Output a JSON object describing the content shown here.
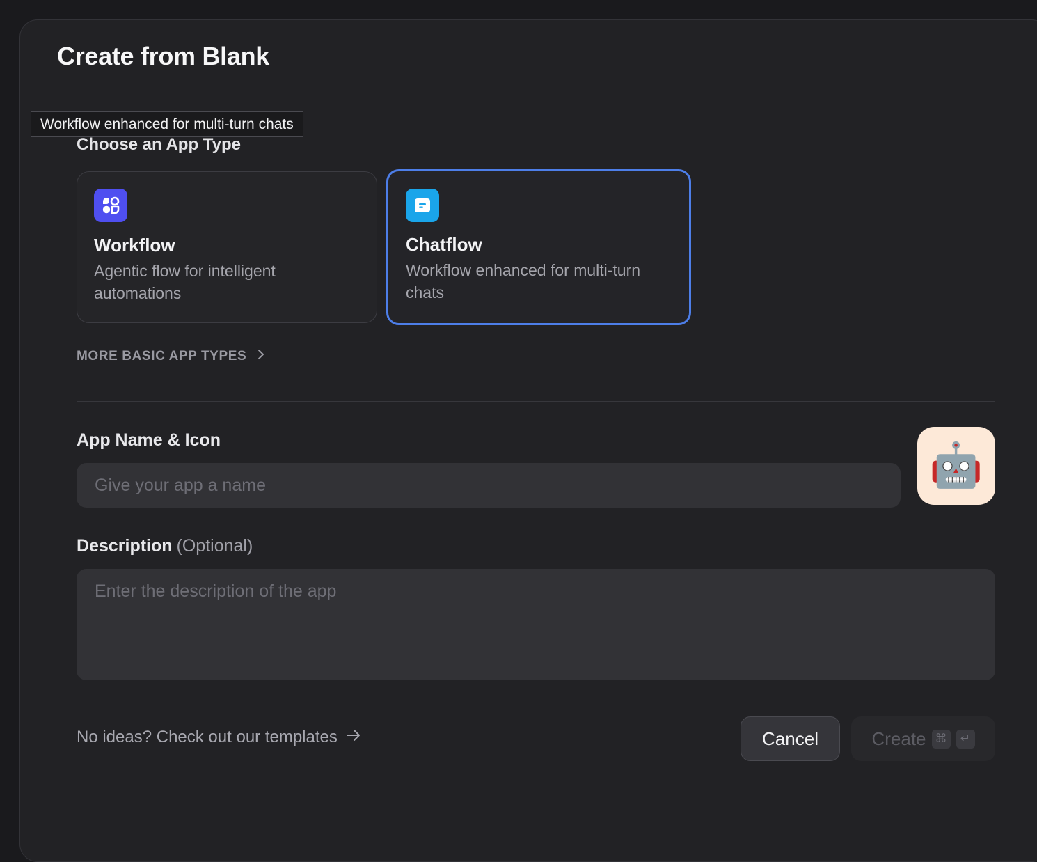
{
  "modal": {
    "title": "Create from Blank",
    "tooltip": "Workflow enhanced for multi-turn chats"
  },
  "app_type": {
    "label": "Choose an App Type",
    "cards": [
      {
        "title": "Workflow",
        "description": "Agentic flow for intelligent automations",
        "icon": "workflow-icon",
        "icon_color": "#4f4ff0",
        "selected": false
      },
      {
        "title": "Chatflow",
        "description": "Workflow enhanced for multi-turn chats",
        "icon": "chatflow-icon",
        "icon_color": "#1aa5ea",
        "selected": true
      }
    ],
    "more_types_label": "MORE BASIC APP TYPES"
  },
  "name_section": {
    "label": "App Name & Icon",
    "placeholder": "Give your app a name",
    "value": "",
    "app_icon": "🤖",
    "app_icon_bg": "#fde9d8"
  },
  "description_section": {
    "label": "Description",
    "optional_label": "(Optional)",
    "placeholder": "Enter the description of the app",
    "value": ""
  },
  "footer": {
    "templates_link": "No ideas? Check out our templates",
    "cancel_label": "Cancel",
    "create_label": "Create",
    "create_shortcut_keys": [
      "⌘",
      "↵"
    ]
  },
  "colors": {
    "selected_border": "#4d7ee8",
    "background": "#222225"
  }
}
